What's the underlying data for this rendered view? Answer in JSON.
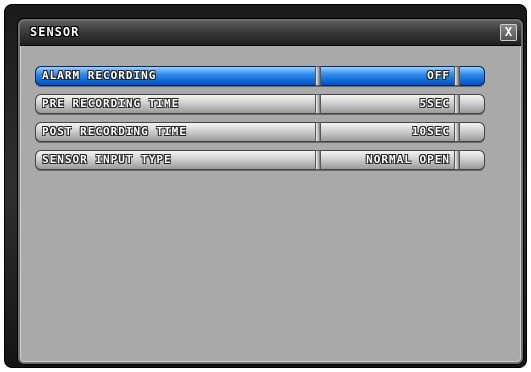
{
  "dialog": {
    "title": "SENSOR",
    "close_label": "X"
  },
  "rows": [
    {
      "label": "ALARM RECORDING",
      "value": "OFF"
    },
    {
      "label": "PRE RECORDING TIME",
      "value": "5SEC"
    },
    {
      "label": "POST RECORDING TIME",
      "value": "10SEC"
    },
    {
      "label": "SENSOR INPUT TYPE",
      "value": "NORMAL OPEN"
    }
  ],
  "colors": {
    "selected_row": "#1f7ae0",
    "panel_background": "#a9a9a9",
    "frame": "#1e1e1e"
  }
}
